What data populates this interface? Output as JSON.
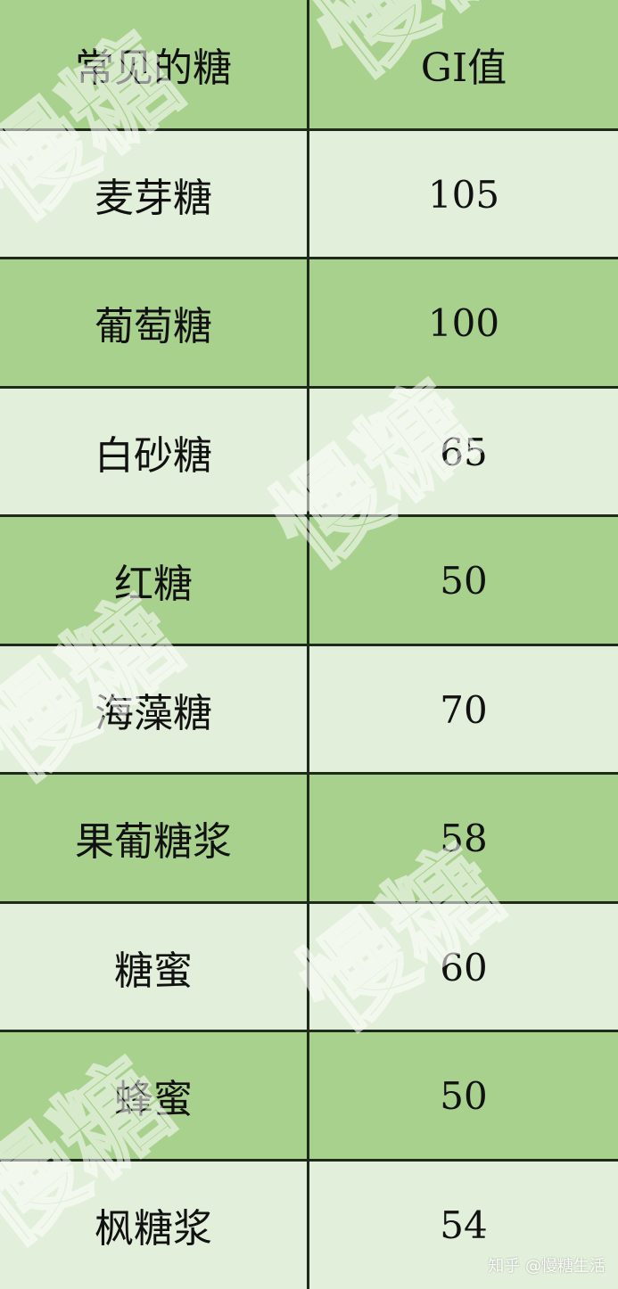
{
  "table": {
    "header": {
      "col1": "常见的糖",
      "col2": "GI值"
    },
    "rows": [
      {
        "name": "麦芽糖",
        "gi": "105"
      },
      {
        "name": "葡萄糖",
        "gi": "100"
      },
      {
        "name": "白砂糖",
        "gi": "65"
      },
      {
        "name": "红糖",
        "gi": "50"
      },
      {
        "name": "海藻糖",
        "gi": "70"
      },
      {
        "name": "果葡糖浆",
        "gi": "58"
      },
      {
        "name": "糖蜜",
        "gi": "60"
      },
      {
        "name": "蜂蜜",
        "gi": "50"
      },
      {
        "name": "枫糖浆",
        "gi": "54"
      }
    ]
  },
  "colors": {
    "dark_row": "#a9d18e",
    "light_row": "#e2efda",
    "grid_line": "#1e2a1a"
  },
  "watermark": {
    "logo_text": "慢糖",
    "attribution": "知乎 @慢糖生活"
  }
}
